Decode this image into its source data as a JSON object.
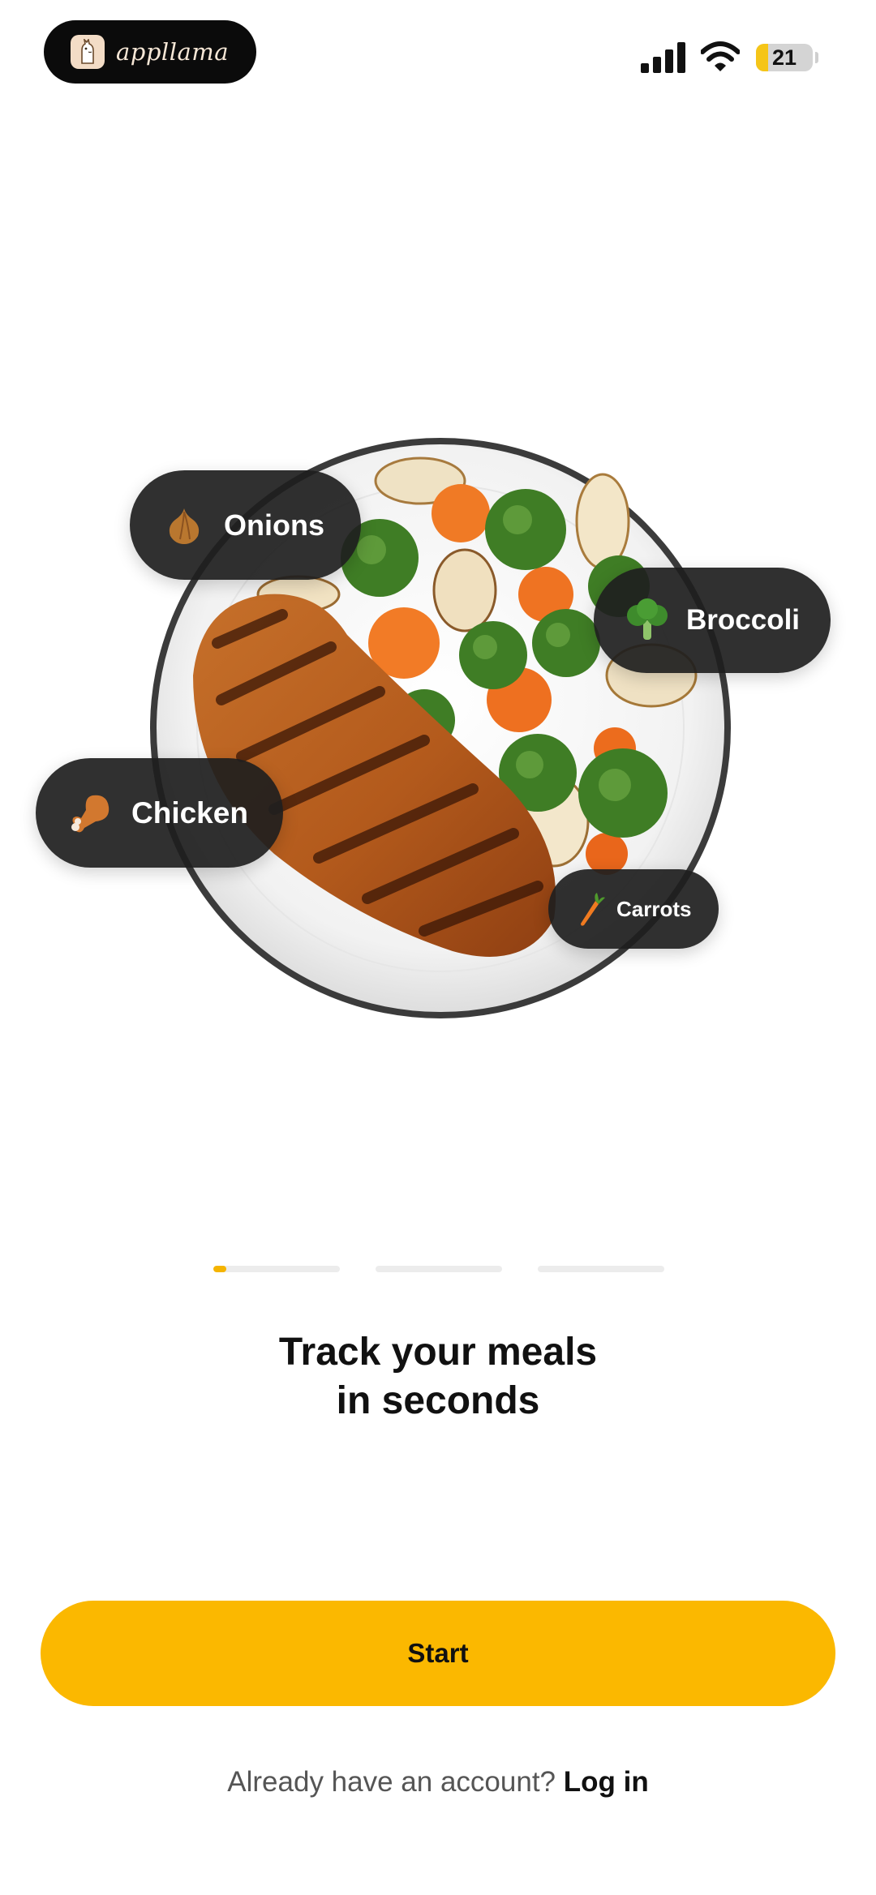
{
  "status_bar": {
    "brand_name": "appllama",
    "battery_level": "21",
    "battery_fraction": 0.21,
    "icons": [
      "llama-logo-icon",
      "cellular-signal-icon",
      "wifi-icon",
      "battery-icon"
    ]
  },
  "hero": {
    "image": "plate-of-grilled-chicken-and-vegetables",
    "chips": {
      "onions": {
        "label": "Onions",
        "icon": "onion-icon"
      },
      "broccoli": {
        "label": "Broccoli",
        "icon": "broccoli-icon"
      },
      "chicken": {
        "label": "Chicken",
        "icon": "drumstick-icon"
      },
      "carrots": {
        "label": "Carrots",
        "icon": "carrot-icon"
      }
    }
  },
  "pager": {
    "page_count": 3,
    "current_index": 0,
    "current_progress": 0.1,
    "accent_color": "#f5b400"
  },
  "onboarding": {
    "headline_line1": "Track your meals",
    "headline_line2": "in seconds"
  },
  "actions": {
    "start_label": "Start",
    "start_color": "#fbb800",
    "login_prompt": "Already have an account?",
    "login_link": "Log in"
  }
}
